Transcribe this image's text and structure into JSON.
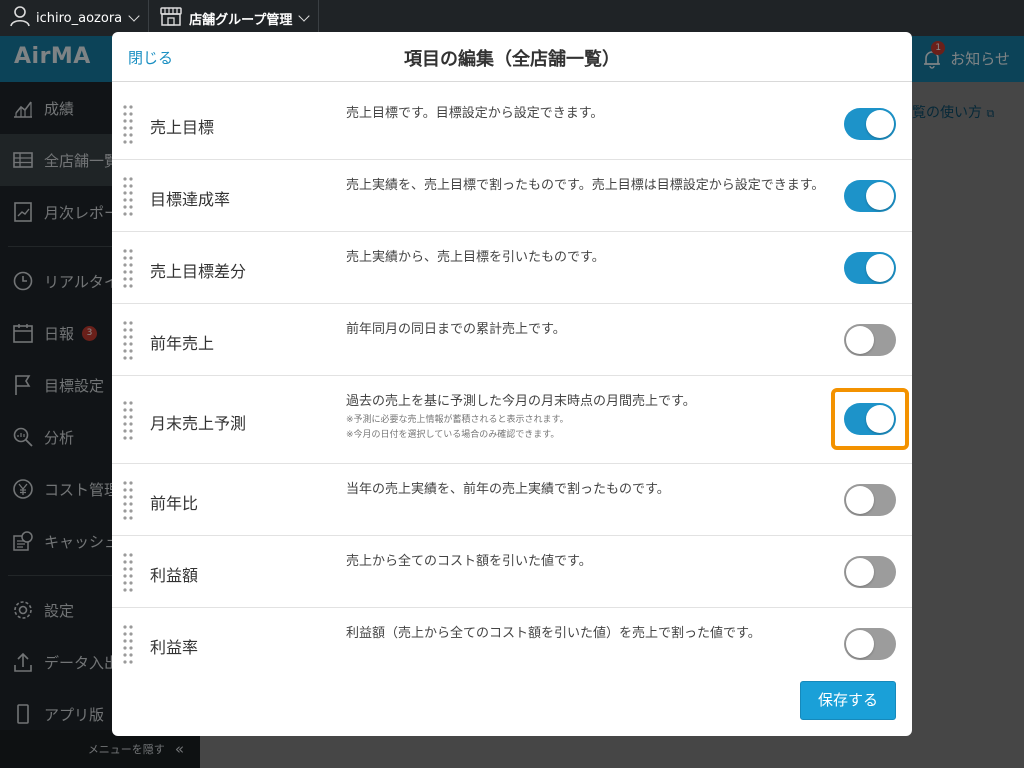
{
  "topbar": {
    "account": "ichiro_aozora",
    "group": "店舗グループ管理"
  },
  "header": {
    "logo": "AirMA",
    "notice": "お知らせ",
    "notice_count": "1"
  },
  "sidebar": {
    "items": [
      {
        "label": "成績",
        "icon": "chart-icon"
      },
      {
        "label": "全店舗一覧",
        "icon": "table-icon"
      },
      {
        "label": "月次レポート",
        "icon": "report-icon"
      },
      {
        "label": "リアルタイム",
        "icon": "clock-icon"
      },
      {
        "label": "日報",
        "icon": "calendar-icon",
        "badge": "3"
      },
      {
        "label": "目標設定",
        "icon": "flag-icon"
      },
      {
        "label": "分析",
        "icon": "magnifier-icon"
      },
      {
        "label": "コスト管理",
        "icon": "yen-icon"
      },
      {
        "label": "キャッシュ",
        "icon": "cash-icon"
      },
      {
        "label": "設定",
        "icon": "gear-icon"
      },
      {
        "label": "データ入出力",
        "icon": "upload-icon"
      },
      {
        "label": "アプリ版",
        "icon": "phone-icon"
      }
    ],
    "hide_menu": "メニューを隠す"
  },
  "main": {
    "howto_link": "覧の使い方"
  },
  "modal": {
    "close": "閉じる",
    "title": "項目の編集（全店舗一覧）",
    "save": "保存する",
    "rows": [
      {
        "name": "売上目標",
        "desc": "売上目標です。目標設定から設定できます。",
        "enabled": true
      },
      {
        "name": "目標達成率",
        "desc": "売上実績を、売上目標で割ったものです。売上目標は目標設定から設定できます。",
        "enabled": true
      },
      {
        "name": "売上目標差分",
        "desc": "売上実績から、売上目標を引いたものです。",
        "enabled": true
      },
      {
        "name": "前年売上",
        "desc": "前年同月の同日までの累計売上です。",
        "enabled": false
      },
      {
        "name": "月末売上予測",
        "desc": "過去の売上を基に予測した今月の月末時点の月間売上です。",
        "note1": "※予測に必要な売上情報が蓄積されると表示されます。",
        "note2": "※今月の日付を選択している場合のみ確認できます。",
        "enabled": true
      },
      {
        "name": "前年比",
        "desc": "当年の売上実績を、前年の売上実績で割ったものです。",
        "enabled": false
      },
      {
        "name": "利益額",
        "desc": "売上から全てのコスト額を引いた値です。",
        "enabled": false
      },
      {
        "name": "利益率",
        "desc": "利益額（売上から全てのコスト額を引いた値）を売上で割った値です。",
        "enabled": false
      }
    ]
  },
  "colors": {
    "toggle_on": "#1d93c9",
    "toggle_off": "#9c9c9c",
    "highlight": "#f39200",
    "save_button": "#1aa0d8"
  }
}
